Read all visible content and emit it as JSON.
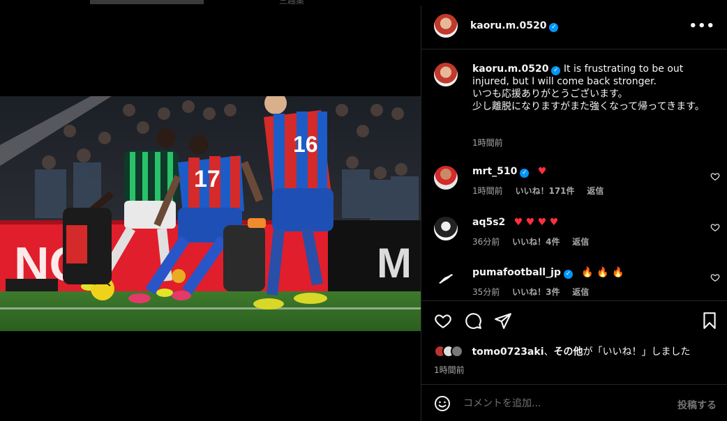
{
  "post": {
    "username": "kaoru.m.0520",
    "caption_line1": "It is frustrating to be out injured, but I will come back stronger.",
    "caption_line2": "いつも応援ありがとうございます。",
    "caption_line3": "少し離脱になりますがまた強くなって帰ってきます。",
    "time": "1時間前",
    "image": {
      "jersey_17": "17",
      "jersey_16": "16"
    }
  },
  "top_partial_text": "三越案",
  "comments": [
    {
      "username": "mrt_510",
      "text": "♥",
      "time": "1時間前",
      "likes": "いいね！171件",
      "reply": "返信",
      "verified": true
    },
    {
      "username": "aq5s2",
      "text": "♥ ♥ ♥ ♥",
      "time": "36分前",
      "likes": "いいね！4件",
      "reply": "返信",
      "verified": false
    },
    {
      "username": "pumafootball_jp",
      "text": "🔥 🔥 🔥",
      "time": "35分前",
      "likes": "いいね！3件",
      "reply": "返信",
      "verified": true
    }
  ],
  "likes_summary": {
    "user": "tomo0723aki",
    "sep": "、",
    "others": "その他",
    "suffix": "が「いいね！」しました",
    "time": "1時間前"
  },
  "comment_bar": {
    "placeholder": "コメントを追加...",
    "post_label": "投稿する"
  },
  "icons": [
    "more-icon",
    "verified-icon",
    "heart-icon",
    "comment-icon",
    "share-icon",
    "bookmark-icon",
    "emoji-icon"
  ],
  "colors": {
    "background": "#000000",
    "verified": "#0095f6",
    "heart_red": "#ff3040",
    "secondary_text": "#a8a8a8",
    "divider": "#262626"
  }
}
